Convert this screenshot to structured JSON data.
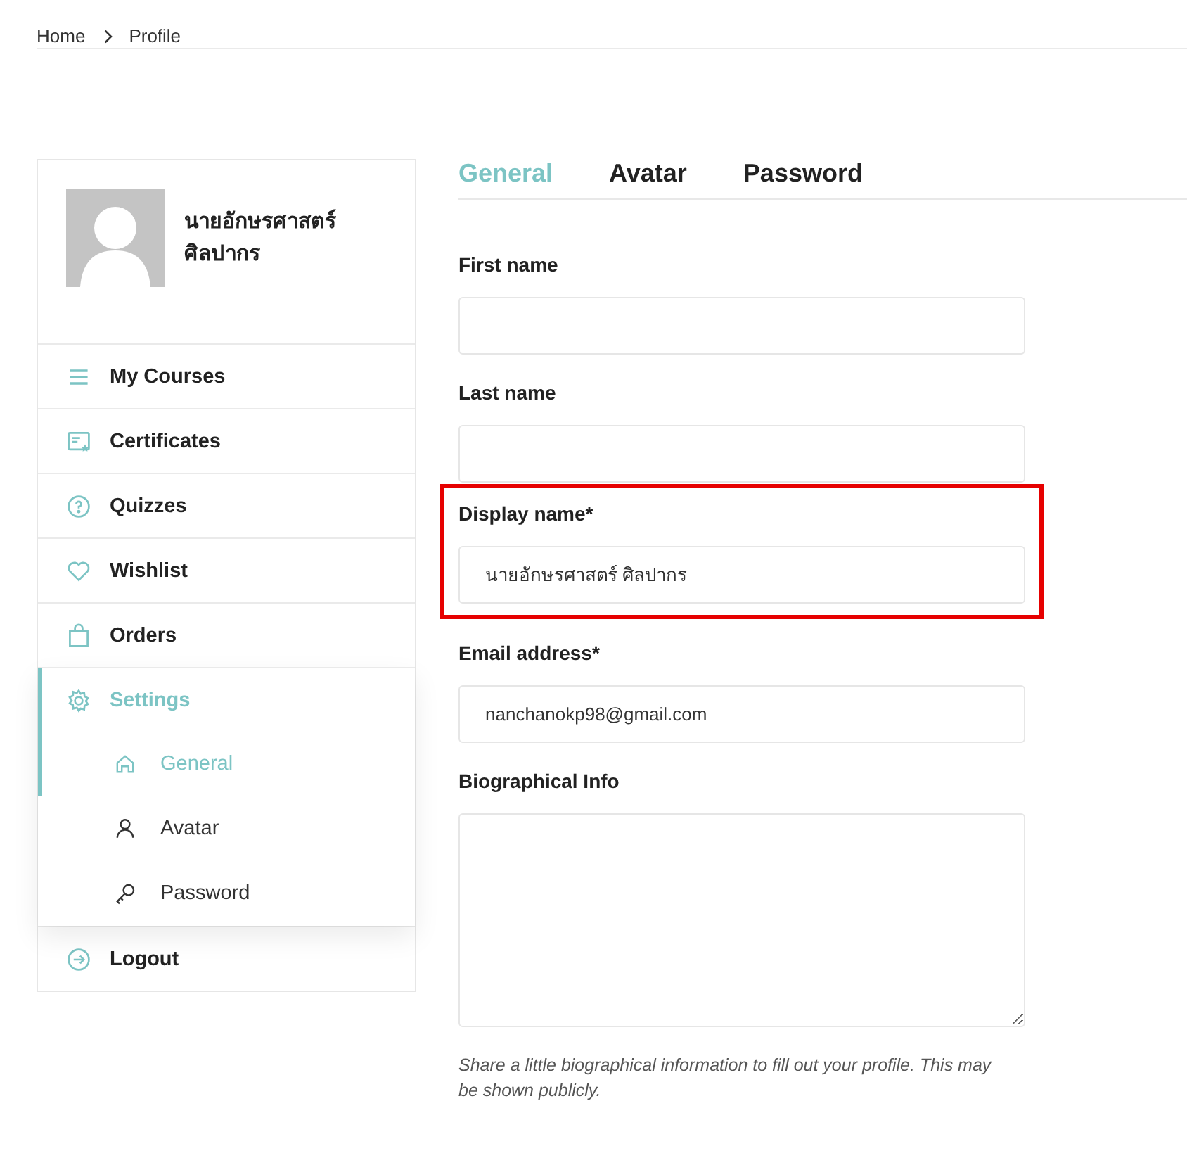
{
  "breadcrumb": [
    "Home",
    "Profile"
  ],
  "profile": {
    "name": "นายอักษรศาสตร์ ศิลปากร"
  },
  "menu": [
    {
      "label": "My Courses",
      "selected": false
    },
    {
      "label": "Certificates",
      "selected": false
    },
    {
      "label": "Quizzes",
      "selected": false
    },
    {
      "label": "Wishlist",
      "selected": false
    },
    {
      "label": "Orders",
      "selected": false
    },
    {
      "label": "Settings",
      "selected": true,
      "expanded": true,
      "children": [
        {
          "label": "General",
          "selected": true
        },
        {
          "label": "Avatar",
          "selected": false
        },
        {
          "label": "Password",
          "selected": false
        }
      ]
    },
    {
      "label": "Logout",
      "selected": false
    }
  ],
  "tabs": [
    {
      "label": "General",
      "selected": true
    },
    {
      "label": "Avatar",
      "selected": false
    },
    {
      "label": "Password",
      "selected": false
    }
  ],
  "fields": [
    {
      "kind": "input",
      "label": "First name",
      "highlighted": false
    },
    {
      "kind": "input",
      "label": "Last name",
      "highlighted": false
    },
    {
      "kind": "input",
      "label": "Display name*",
      "value": "นายอักษรศาสตร์ ศิลปากร",
      "highlighted": true
    },
    {
      "kind": "input",
      "label": "Email address*",
      "value": "nanchanokp98@gmail.com",
      "highlighted": false
    },
    {
      "kind": "textarea",
      "label": "Biographical Info",
      "highlighted": false
    }
  ],
  "help": "Share a little biographical information to fill out your profile. This may be shown publicly."
}
